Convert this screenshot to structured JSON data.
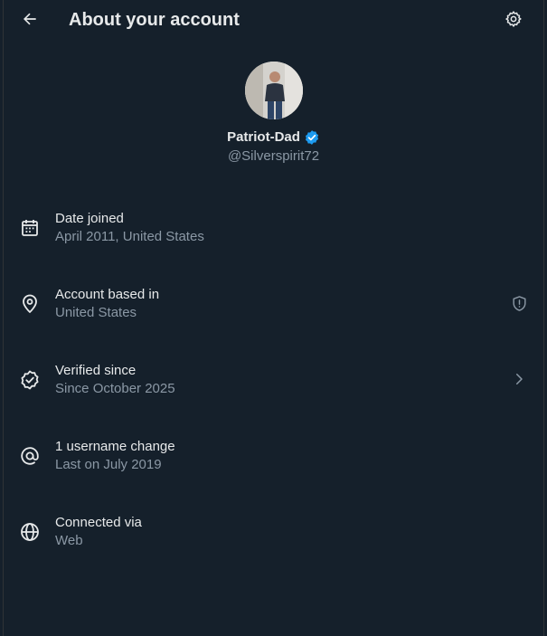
{
  "header": {
    "title": "About your account",
    "back_icon": "arrow-left-icon",
    "settings_icon": "gear-icon"
  },
  "profile": {
    "display_name": "Patriot-Dad",
    "handle": "@Silverspirit72",
    "verified": true,
    "verified_color": "#1d9bf0"
  },
  "details": [
    {
      "label": "Date joined",
      "value": "April 2011, United States",
      "icon": "calendar-icon"
    },
    {
      "label": "Account based in",
      "value": "United States",
      "icon": "location-pin-icon",
      "trailing_icon": "shield-alert-icon"
    },
    {
      "label": "Verified since",
      "value": "Since October 2025",
      "icon": "verified-badge-icon",
      "trailing_icon": "chevron-right-icon"
    },
    {
      "label": "1 username change",
      "value": "Last on July 2019",
      "icon": "at-sign-icon"
    },
    {
      "label": "Connected via",
      "value": "Web",
      "icon": "globe-icon"
    }
  ],
  "colors": {
    "background": "#15202b",
    "primary_text": "#e7e9ea",
    "secondary_text": "#8b98a5"
  }
}
